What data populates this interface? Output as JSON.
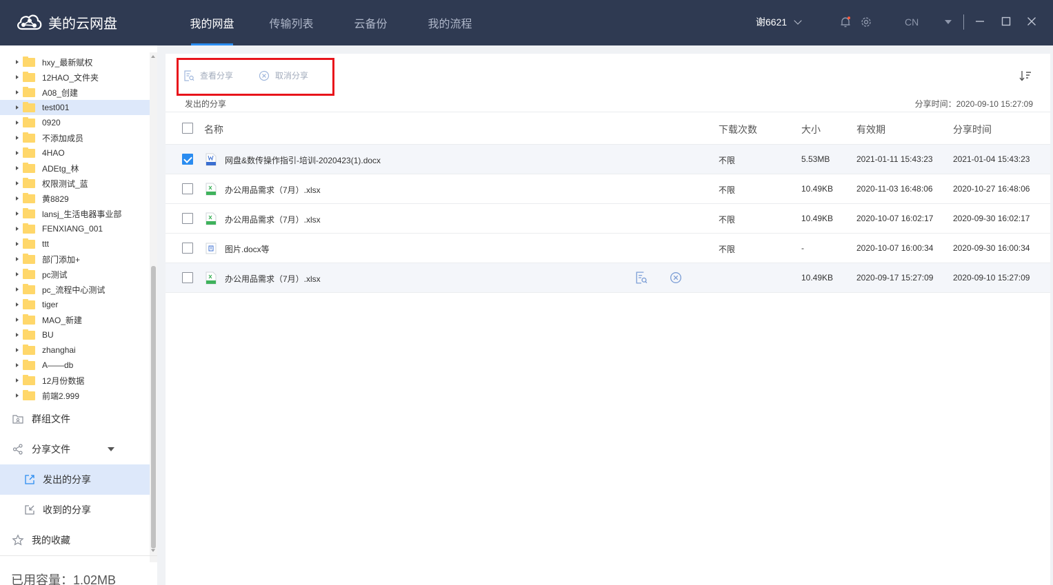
{
  "app": {
    "title": "美的云网盘"
  },
  "nav": {
    "tabs": [
      "我的网盘",
      "传输列表",
      "云备份",
      "我的流程"
    ],
    "active_index": 0
  },
  "user": {
    "name": "谢6621",
    "lang": "CN"
  },
  "colors": {
    "topbar": "#2f3a52",
    "accent": "#2a8cf0",
    "highlight_box": "#e8141b",
    "folder": "#ffd76a"
  },
  "sidebar": {
    "folders": [
      "hxy_最新赋权",
      "12HAO_文件夹",
      "A08_创建",
      "test001",
      "0920",
      "不添加成员",
      "4HAO",
      "ADEtg_林",
      "权限测试_蓝",
      "黄8829",
      "lansj_生活电器事业部",
      "FENXIANG_001",
      "ttt",
      "部门添加+",
      "pc测试",
      "pc_流程中心测试",
      "tiger",
      "MAO_新建",
      "BU",
      "zhanghai",
      "A——db",
      "12月份数据",
      "前端2.999"
    ],
    "selected_folder": "test001",
    "menu": {
      "group_files": "群组文件",
      "shared_files": "分享文件",
      "sent_shares": "发出的分享",
      "received_shares": "收到的分享",
      "favorites": "我的收藏"
    },
    "capacity": "已用容量：1.02MB"
  },
  "toolbar": {
    "view_share": "查看分享",
    "cancel_share": "取消分享"
  },
  "section": {
    "title": "发出的分享",
    "share_time": "分享时间：2020-09-10 15:27:09"
  },
  "table": {
    "columns": {
      "name": "名称",
      "downloads": "下载次数",
      "size": "大小",
      "expiry": "有效期",
      "share_time": "分享时间"
    },
    "rows": [
      {
        "name": "网盘&数传操作指引-培训-2020423(1).docx",
        "type": "docx",
        "downloads": "不限",
        "size": "5.53MB",
        "expiry": "2021-01-11 15:43:23",
        "share_time": "2021-01-04 15:43:23",
        "checked": true
      },
      {
        "name": "办公用品需求（7月）.xlsx",
        "type": "xlsx",
        "downloads": "不限",
        "size": "10.49KB",
        "expiry": "2020-11-03 16:48:06",
        "share_time": "2020-10-27 16:48:06",
        "checked": false
      },
      {
        "name": "办公用品需求（7月）.xlsx",
        "type": "xlsx",
        "downloads": "不限",
        "size": "10.49KB",
        "expiry": "2020-10-07 16:02:17",
        "share_time": "2020-09-30 16:02:17",
        "checked": false
      },
      {
        "name": "图片.docx等",
        "type": "multi",
        "downloads": "不限",
        "size": "-",
        "expiry": "2020-10-07 16:00:34",
        "share_time": "2020-09-30 16:00:34",
        "checked": false
      },
      {
        "name": "办公用品需求（7月）.xlsx",
        "type": "xlsx",
        "downloads": "",
        "size": "10.49KB",
        "expiry": "2020-09-17 15:27:09",
        "share_time": "2020-09-10 15:27:09",
        "checked": false
      }
    ]
  }
}
